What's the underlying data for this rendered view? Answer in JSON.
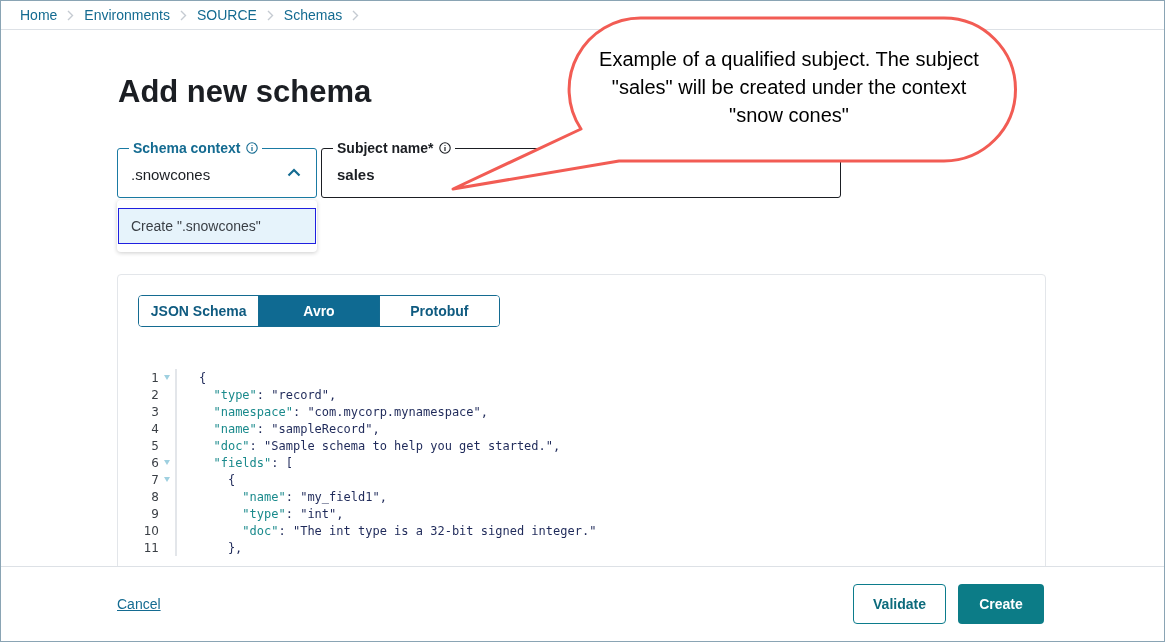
{
  "breadcrumbs": [
    "Home",
    "Environments",
    "SOURCE",
    "Schemas"
  ],
  "title": "Add new schema",
  "schema_context": {
    "label": "Schema context",
    "value": ".snowcones",
    "expanded": true,
    "options": [
      {
        "label": "Create \".snowcones\"",
        "selected": true
      }
    ]
  },
  "subject_name": {
    "label": "Subject name*",
    "value": "sales"
  },
  "format_tabs": [
    {
      "label": "JSON Schema",
      "selected": false
    },
    {
      "label": "Avro",
      "selected": true
    },
    {
      "label": "Protobuf",
      "selected": false
    }
  ],
  "editor_lines": [
    {
      "number": "1",
      "fold": true,
      "code": "{"
    },
    {
      "number": "2",
      "fold": false,
      "code": "  \"type\": \"record\","
    },
    {
      "number": "3",
      "fold": false,
      "code": "  \"namespace\": \"com.mycorp.mynamespace\","
    },
    {
      "number": "4",
      "fold": false,
      "code": "  \"name\": \"sampleRecord\","
    },
    {
      "number": "5",
      "fold": false,
      "code": "  \"doc\": \"Sample schema to help you get started.\","
    },
    {
      "number": "6",
      "fold": true,
      "code": "  \"fields\": ["
    },
    {
      "number": "7",
      "fold": true,
      "code": "    {"
    },
    {
      "number": "8",
      "fold": false,
      "code": "      \"name\": \"my_field1\","
    },
    {
      "number": "9",
      "fold": false,
      "code": "      \"type\": \"int\","
    },
    {
      "number": "10",
      "fold": false,
      "code": "      \"doc\": \"The int type is a 32-bit signed integer.\""
    },
    {
      "number": "11",
      "fold": false,
      "code": "    },"
    }
  ],
  "footer": {
    "cancel": "Cancel",
    "validate": "Validate",
    "create": "Create"
  },
  "callout": "Example of a qualified subject. The subject \"sales\" will be created under the context \"snow cones\""
}
